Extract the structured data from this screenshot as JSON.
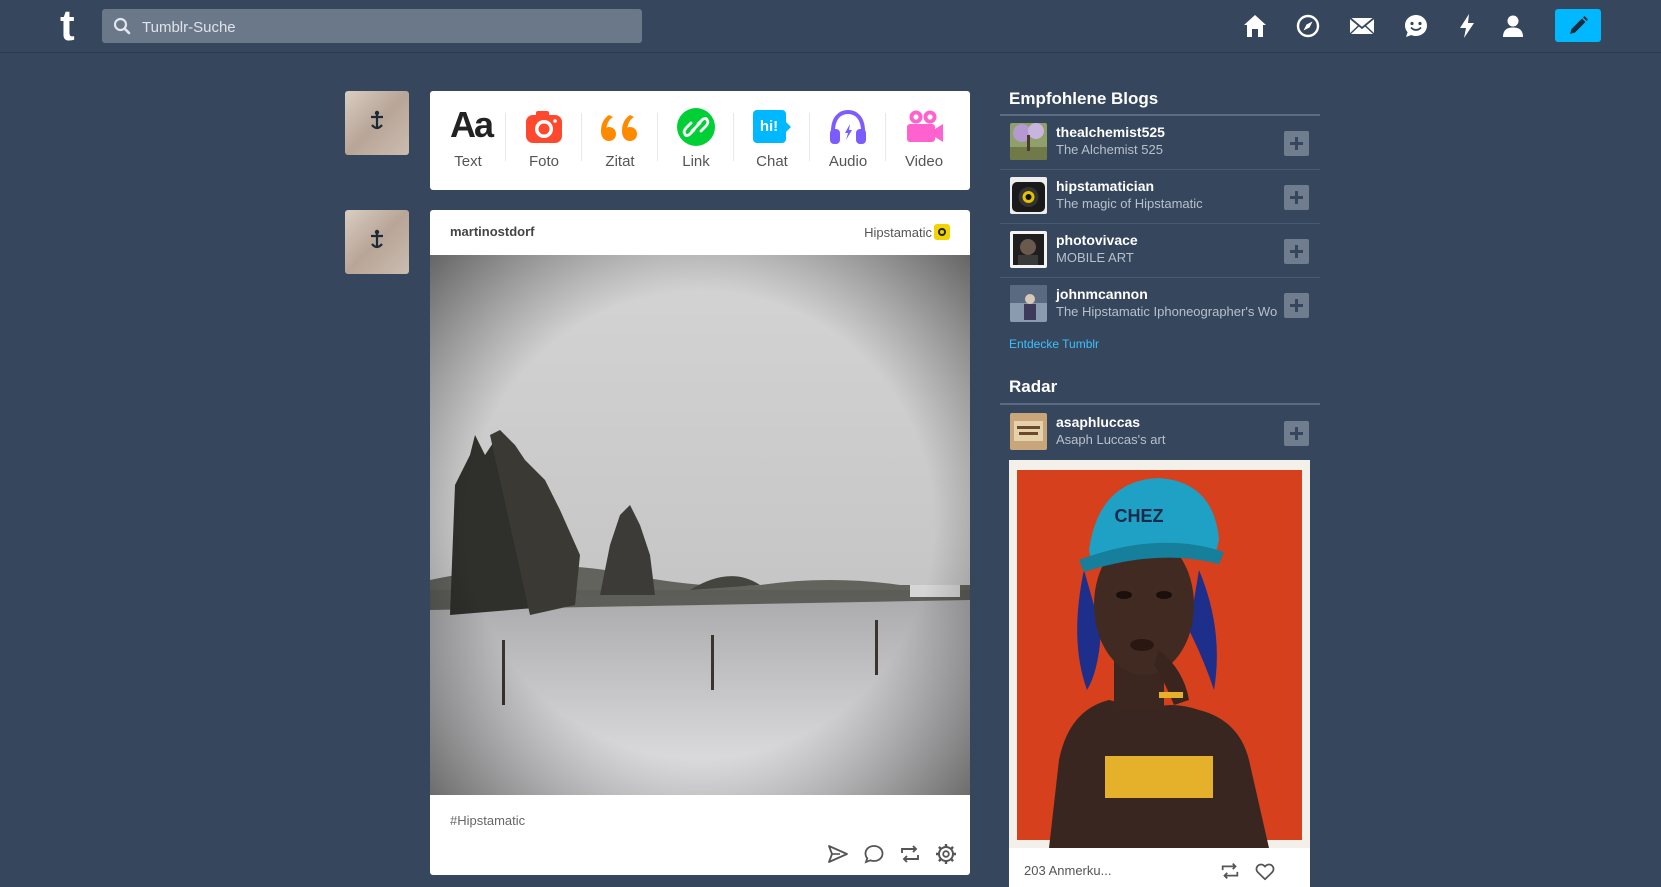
{
  "header": {
    "logo": "t",
    "search_placeholder": "Tumblr-Suche",
    "nav_icons": [
      "home-icon",
      "explore-icon",
      "inbox-icon",
      "messaging-icon",
      "activity-icon",
      "account-icon"
    ],
    "compose_icon": "pencil-icon",
    "accent_color": "#00b8ff"
  },
  "post_types": [
    {
      "label": "Text",
      "icon": "text-icon",
      "color": "#222222"
    },
    {
      "label": "Foto",
      "icon": "camera-icon",
      "color": "#ff492f"
    },
    {
      "label": "Zitat",
      "icon": "quote-icon",
      "color": "#ff8a00"
    },
    {
      "label": "Link",
      "icon": "link-icon",
      "color": "#00cf35"
    },
    {
      "label": "Chat",
      "icon": "chat-icon",
      "color": "#00b8ff"
    },
    {
      "label": "Audio",
      "icon": "headphones-icon",
      "color": "#7c5cff"
    },
    {
      "label": "Video",
      "icon": "video-camera-icon",
      "color": "#ff62ce"
    }
  ],
  "post": {
    "author": "martinostdorf",
    "source": "Hipstamatic",
    "tag": "#Hipstamatic",
    "actions": [
      "share-icon",
      "reply-icon",
      "reblog-icon",
      "settings-icon"
    ]
  },
  "sidebar": {
    "recommended_title": "Empfohlene Blogs",
    "blogs": [
      {
        "name": "thealchemist525",
        "desc": "The Alchemist 525"
      },
      {
        "name": "hipstamatician",
        "desc": "The magic of Hipstamatic"
      },
      {
        "name": "photovivace",
        "desc": "MOBILE ART"
      },
      {
        "name": "johnmcannon",
        "desc": "The Hipstamatic Iphoneographer's Wo"
      }
    ],
    "explore_link": "Entdecke Tumblr",
    "radar_title": "Radar",
    "radar": {
      "name": "asaphluccas",
      "desc": "Asaph Luccas's art",
      "notes": "203 Anmerku...",
      "image_cap_text": "CHEZ"
    }
  }
}
